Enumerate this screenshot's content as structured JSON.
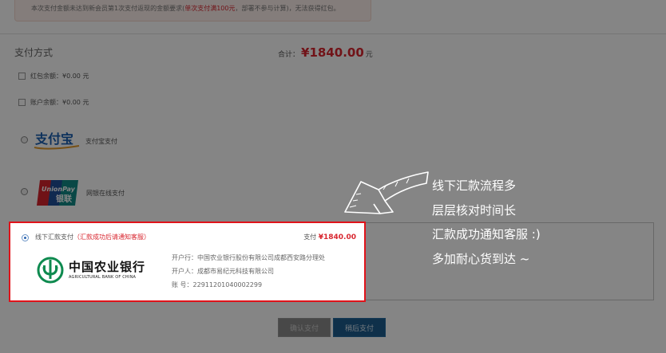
{
  "notice": {
    "text_before": "本次支付金额未达到新会员第1次支付返现的金额要求(",
    "text_red": "单次支付满100元",
    "text_after": "，部署不参与计算)，无法获得红包。"
  },
  "payment": {
    "section_title": "支付方式",
    "total_label": "合计：",
    "total_amount": "¥1840.00",
    "total_unit": "元",
    "options": {
      "redpacket_label": "红包余额：¥0.00 元",
      "account_label": "账户余额：¥0.00 元",
      "alipay_logo_text": "支付宝",
      "alipay_label": "支付宝支付",
      "unionpay_logo_top": "UnionPay",
      "unionpay_logo_bottom": "银联",
      "unionpay_label": "网银在线支付"
    }
  },
  "offline": {
    "title": "线下汇款支付",
    "title_note": "（汇款成功后请通知客服）",
    "pay_label": "支付",
    "pay_amount": "¥1840.00",
    "bank_name_cn": "中国农业银行",
    "bank_name_en": "AGRICULTURAL BANK OF CHINA",
    "bank_line": "开户行：中国农业银行股份有限公司成都西安路分理处",
    "holder_line": "开户人：成都市易纪元科技有限公司",
    "account_line": "账    号：22911201040002299"
  },
  "hint": {
    "lines": [
      "线下汇款流程多",
      "层层核对时间长",
      "汇款成功通知客服 :)",
      "多加耐心货到达 ~"
    ]
  },
  "buttons": {
    "confirm": "确认支付",
    "later": "稍后支付"
  },
  "colors": {
    "accent_red": "#d8262f",
    "highlight_border": "#e0131a",
    "button_blue": "#1d5d8e",
    "abc_green": "#0e8a4f"
  }
}
